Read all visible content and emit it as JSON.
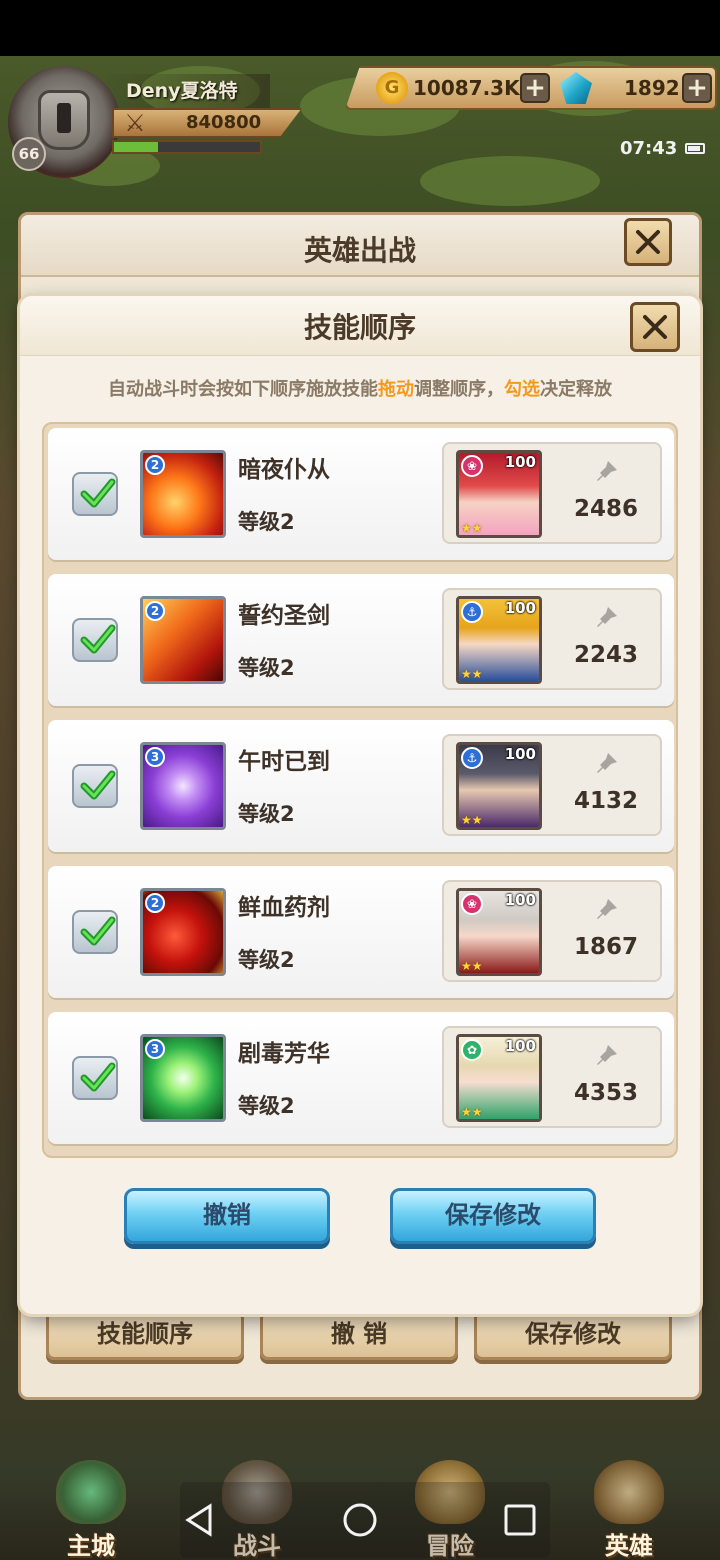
{
  "hud": {
    "player_name": "Deny夏洛特",
    "player_level": "66",
    "power": "840800",
    "exp_fraction": 0.3,
    "gold": "10087.3K",
    "gems": "1892",
    "time": "07:43"
  },
  "background_panel": {
    "title": "英雄出战",
    "buttons": [
      "技能顺序",
      "撤 销",
      "保存修改"
    ]
  },
  "modal": {
    "title": "技能顺序",
    "hint_parts": [
      "自动战斗时会按如下顺序施放技能",
      "拖动",
      "调整顺序，",
      "勾选",
      "决定释放"
    ],
    "highlight_color": "#f39a1e",
    "skills": [
      {
        "name": "暗夜仆从",
        "level": "等级2",
        "badge": "2",
        "checked": true,
        "hero_level": "100",
        "value": "2486",
        "hero_class": "heart",
        "hero_class_color": "#d6336c"
      },
      {
        "name": "誓约圣剑",
        "level": "等级2",
        "badge": "2",
        "checked": true,
        "hero_level": "100",
        "value": "2243",
        "hero_class": "anchor",
        "hero_class_color": "#2d6fd6"
      },
      {
        "name": "午时已到",
        "level": "等级2",
        "badge": "3",
        "checked": true,
        "hero_level": "100",
        "value": "4132",
        "hero_class": "anchor",
        "hero_class_color": "#2d6fd6"
      },
      {
        "name": "鲜血药剂",
        "level": "等级2",
        "badge": "2",
        "checked": true,
        "hero_level": "100",
        "value": "1867",
        "hero_class": "heart",
        "hero_class_color": "#d6336c"
      },
      {
        "name": "剧毒芳华",
        "level": "等级2",
        "badge": "3",
        "checked": true,
        "hero_level": "100",
        "value": "4353",
        "hero_class": "leaf",
        "hero_class_color": "#2fb36a"
      }
    ],
    "cancel_label": "撤销",
    "save_label": "保存修改"
  },
  "nav": {
    "items": [
      "主城",
      "战斗",
      "冒险",
      "英雄"
    ]
  }
}
